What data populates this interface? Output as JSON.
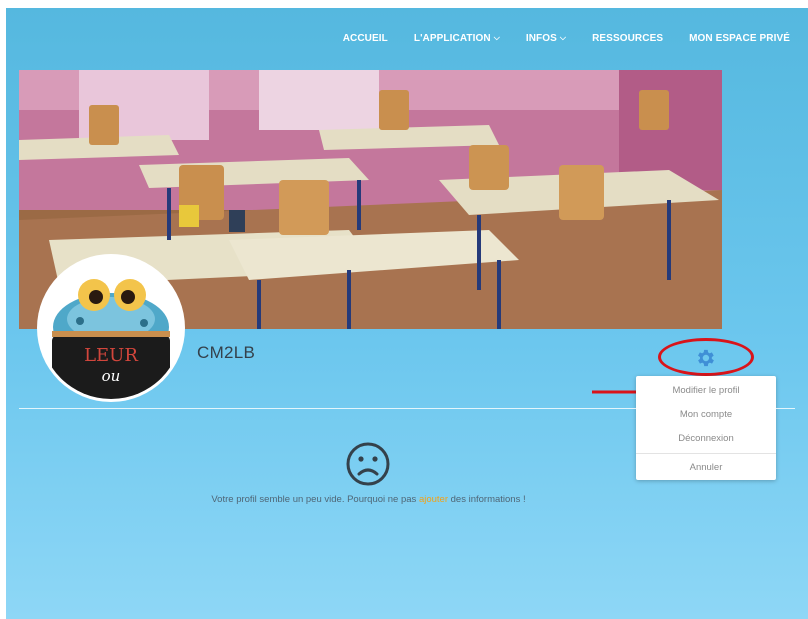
{
  "nav": {
    "items": [
      {
        "label": "ACCUEIL",
        "has_dropdown": false
      },
      {
        "label": "L'APPLICATION",
        "has_dropdown": true
      },
      {
        "label": "INFOS",
        "has_dropdown": true
      },
      {
        "label": "RESSOURCES",
        "has_dropdown": false
      },
      {
        "label": "MON ESPACE PRIVÉ",
        "has_dropdown": false
      }
    ]
  },
  "profile": {
    "username": "CM2LB",
    "avatar_text_line1": "LEUR",
    "avatar_text_line2": "ou"
  },
  "settings_menu": {
    "items": [
      "Modifier le profil",
      "Mon compte",
      "Déconnexion"
    ],
    "cancel": "Annuler"
  },
  "empty_state": {
    "text_before": "Votre profil semble un peu vide. Pourquoi ne pas ",
    "link": "ajouter",
    "text_after": " des informations !"
  },
  "colors": {
    "background": "#6cc7ee",
    "accent_link": "#f0a21a",
    "annotation_red": "#d9141a",
    "gear": "#3f8fd6"
  },
  "icons": [
    "chevron-down-icon",
    "gear-icon",
    "sad-face-icon",
    "frog-icon",
    "arrow-right-icon"
  ]
}
